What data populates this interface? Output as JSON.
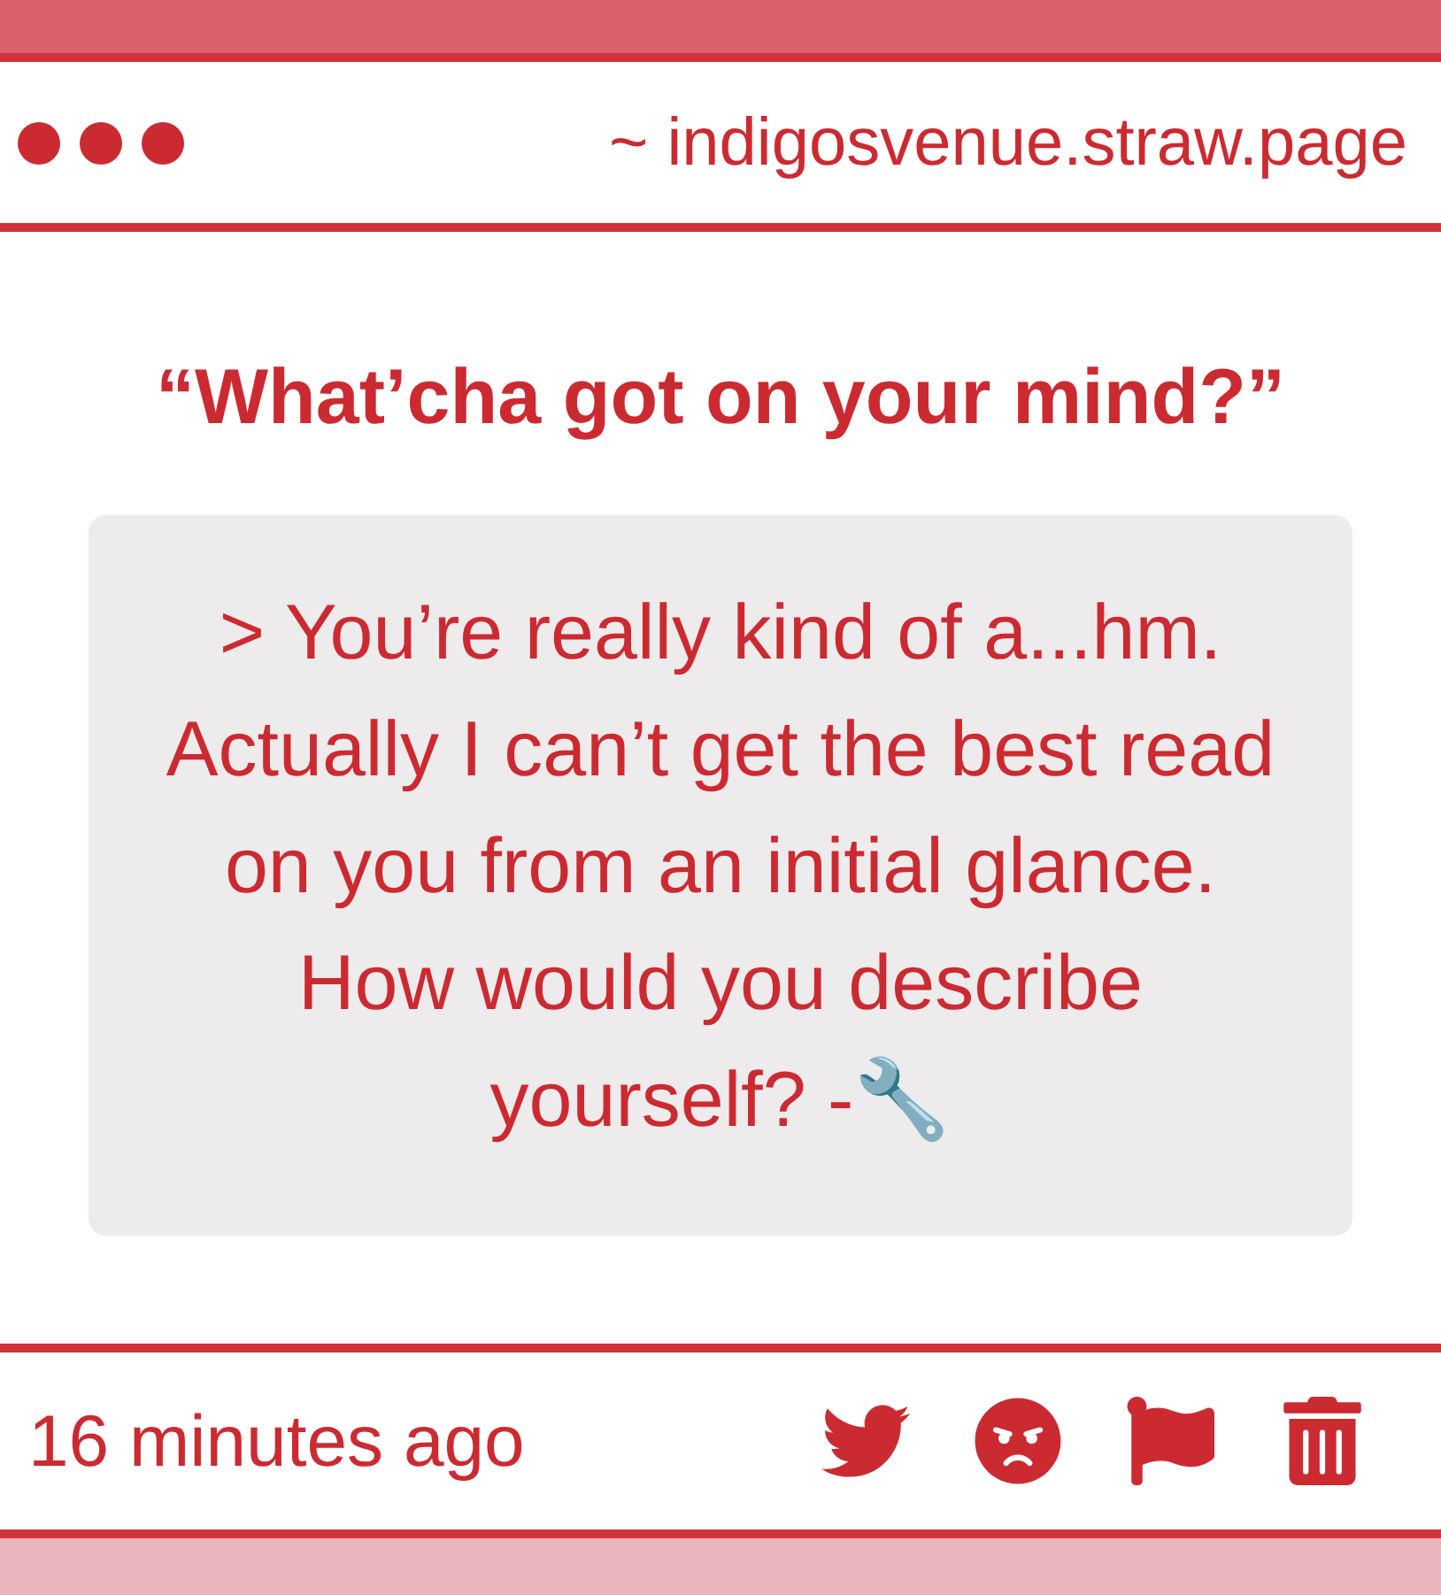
{
  "header": {
    "url": "~ indigosvenue.straw.page"
  },
  "prompt": "“What’cha got on your mind?”",
  "message": {
    "text": "> You’re really kind of a...hm. Actually I can’t get the best read on you from an initial glance. How would you describe yourself? -🔧"
  },
  "footer": {
    "timestamp": "16 minutes ago"
  }
}
